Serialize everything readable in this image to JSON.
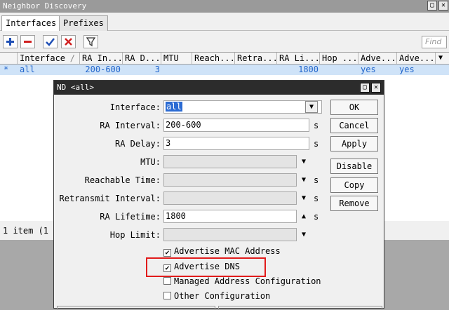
{
  "main_window": {
    "title": "Neighbor Discovery",
    "tabs": [
      {
        "label": "Interfaces",
        "active": true
      },
      {
        "label": "Prefixes",
        "active": false
      }
    ],
    "find_placeholder": "Find",
    "columns": [
      "Interface",
      "RA In...",
      "RA D...",
      "MTU",
      "Reach...",
      "Retra...",
      "RA Li...",
      "Hop ...",
      "Adve...",
      "Adve..."
    ],
    "row": {
      "marker": "*",
      "interface": "all",
      "ra_interval": "200-600",
      "ra_delay": "3",
      "ra_lifetime": "1800",
      "adv_mac": "yes",
      "adv_dns": "yes"
    },
    "status": "1 item (1"
  },
  "dialog": {
    "title": "ND <all>",
    "fields": {
      "interface": {
        "label": "Interface:",
        "value": "all"
      },
      "ra_interval": {
        "label": "RA Interval:",
        "value": "200-600",
        "unit": "s"
      },
      "ra_delay": {
        "label": "RA Delay:",
        "value": "3",
        "unit": "s"
      },
      "mtu": {
        "label": "MTU:",
        "value": ""
      },
      "reachable_time": {
        "label": "Reachable Time:",
        "value": "",
        "unit": "s"
      },
      "retransmit_interval": {
        "label": "Retransmit Interval:",
        "value": "",
        "unit": "s"
      },
      "ra_lifetime": {
        "label": "RA Lifetime:",
        "value": "1800",
        "unit": "s"
      },
      "hop_limit": {
        "label": "Hop Limit:",
        "value": ""
      }
    },
    "checkboxes": [
      {
        "label": "Advertise MAC Address",
        "checked": true
      },
      {
        "label": "Advertise DNS",
        "checked": true
      },
      {
        "label": "Managed Address Configuration",
        "checked": false
      },
      {
        "label": "Other Configuration",
        "checked": false
      }
    ],
    "buttons": {
      "ok": "OK",
      "cancel": "Cancel",
      "apply": "Apply",
      "disable": "Disable",
      "copy": "Copy",
      "remove": "Remove"
    }
  },
  "colors": {
    "selection": "#2b6bd3",
    "highlight_box": "#e11b1b",
    "row_text": "#2266cc",
    "add_icon": "#1f4fb5",
    "remove_icon": "#d01f1f"
  },
  "icons": [
    "plus-icon",
    "minus-icon",
    "check-icon",
    "cross-icon",
    "filter-icon",
    "restore-icon",
    "close-icon",
    "dropdown-icon",
    "spin-down-icon",
    "spin-up-icon"
  ]
}
